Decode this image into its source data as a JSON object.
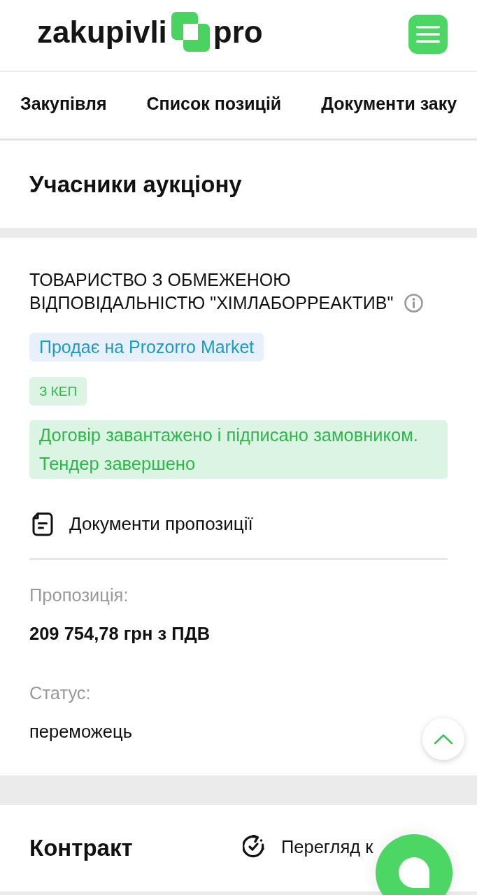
{
  "header": {
    "logo": {
      "before": "zakupivli",
      "after": "pro"
    }
  },
  "tabs": [
    {
      "label": "Закупівля",
      "selected": false
    },
    {
      "label": "Список позицій",
      "selected": false
    },
    {
      "label": "Документи заку",
      "selected": false
    }
  ],
  "participants_section": {
    "title": "Учасники аукціону"
  },
  "participant": {
    "name": "ТОВАРИСТВО З ОБМЕЖЕНОЮ ВІДПОВІДАЛЬНІСТЮ \"ХІМЛАБОРРЕАКТИВ\"",
    "tags": [
      {
        "label": "Продає на Prozorro Market",
        "kind": "info"
      },
      {
        "label": "З КЕП",
        "kind": "success"
      }
    ],
    "notice": [
      "Договір завантажено і підписано замовником.",
      "Тендер завершено"
    ],
    "documents_link": "Документи пропозиції",
    "fields": [
      {
        "label": "Пропозиція:",
        "value": "209 754,78 грн з ПДВ",
        "kind": "amount"
      },
      {
        "label": "Статус:",
        "value": "переможець",
        "kind": "status"
      }
    ]
  },
  "contract": {
    "title": "Контракт",
    "link": "Перегляд к"
  }
}
